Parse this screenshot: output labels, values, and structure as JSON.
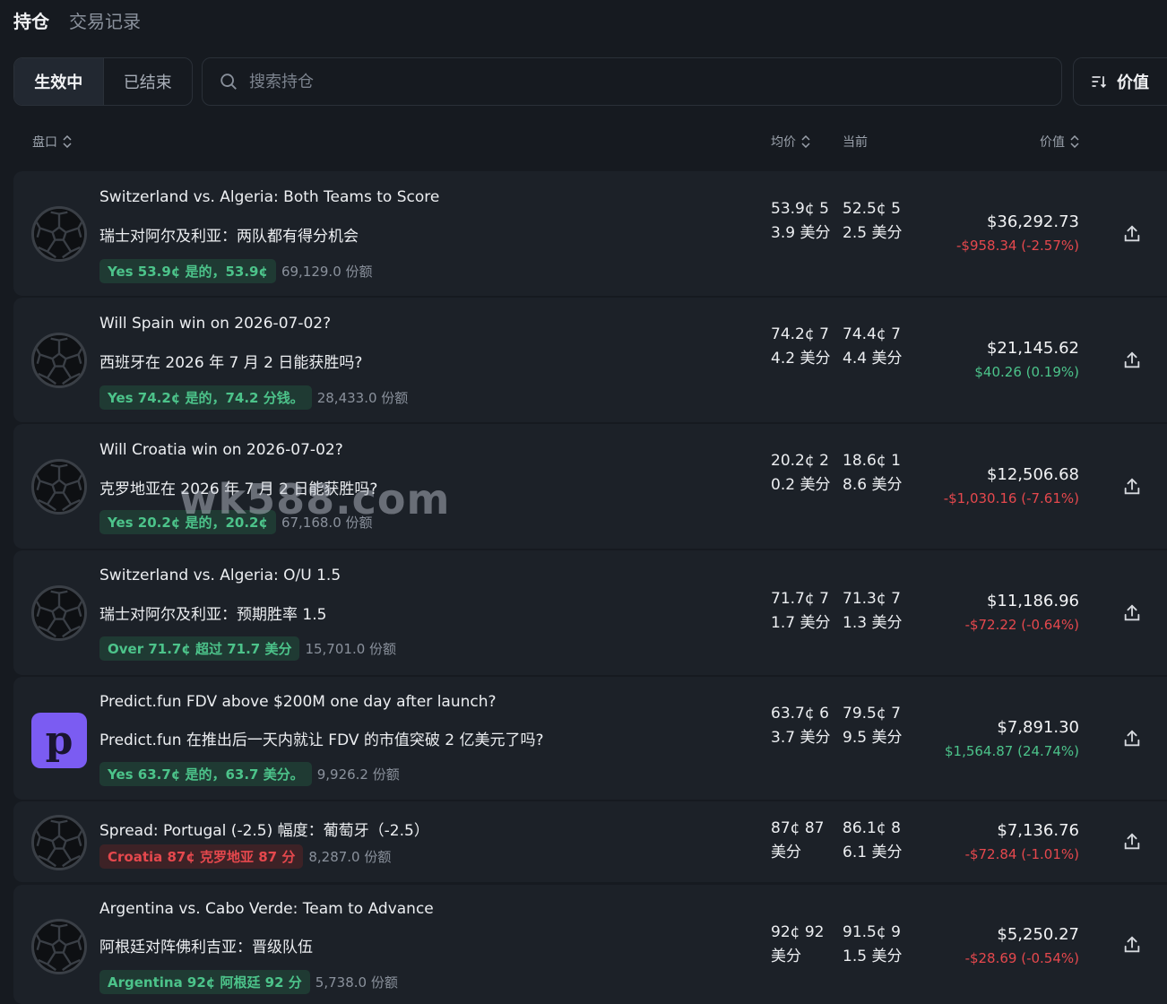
{
  "tabs": [
    {
      "label": "持仓"
    },
    {
      "label": "交易记录"
    }
  ],
  "filter": {
    "active_label": "生效中",
    "ended_label": "已结束"
  },
  "search": {
    "placeholder": "搜索持仓",
    "value": ""
  },
  "sort": {
    "label": "价值"
  },
  "columns": {
    "market": "盘口",
    "avg": "均价",
    "current": "当前",
    "value": "价值"
  },
  "rows": [
    {
      "icon": "soccer-ball-icon",
      "title_en": "Switzerland vs. Algeria: Both Teams to Score",
      "title_zh": "瑞士对阿尔及利亚：两队都有得分机会",
      "tag": "Yes 53.9¢  是的，53.9¢",
      "tag_kind": "yes",
      "shares": "69,129.0 份额",
      "avg": "53.9¢ 53.9 美分",
      "current": "52.5¢ 52.5 美分",
      "value": "$36,292.73",
      "pnl": "-$958.34 (-2.57%)",
      "pnl_kind": "neg"
    },
    {
      "icon": "soccer-ball-icon",
      "title_en": "Will Spain win on 2026-07-02?",
      "title_zh": "西班牙在 2026 年 7 月 2 日能获胜吗?",
      "tag": "Yes 74.2¢  是的，74.2 分钱。",
      "tag_kind": "yes",
      "shares": "28,433.0 份额",
      "avg": "74.2¢ 74.2 美分",
      "current": "74.4¢ 74.4 美分",
      "value": "$21,145.62",
      "pnl": "$40.26 (0.19%)",
      "pnl_kind": "pos"
    },
    {
      "icon": "soccer-ball-icon",
      "title_en": "Will Croatia win on 2026-07-02?",
      "title_zh": "克罗地亚在 2026 年 7 月 2 日能获胜吗?",
      "tag": "Yes 20.2¢  是的，20.2¢",
      "tag_kind": "yes",
      "shares": "67,168.0 份额",
      "avg": "20.2¢ 20.2 美分",
      "current": "18.6¢ 18.6 美分",
      "value": "$12,506.68",
      "pnl": "-$1,030.16 (-7.61%)",
      "pnl_kind": "neg"
    },
    {
      "icon": "soccer-ball-icon",
      "title_en": "Switzerland vs. Algeria: O/U 1.5",
      "title_zh": "瑞士对阿尔及利亚：预期胜率 1.5",
      "tag": "Over 71.7¢  超过 71.7 美分",
      "tag_kind": "yes",
      "shares": "15,701.0 份额",
      "avg": "71.7¢ 71.7 美分",
      "current": "71.3¢ 71.3 美分",
      "value": "$11,186.96",
      "pnl": "-$72.22 (-0.64%)",
      "pnl_kind": "neg"
    },
    {
      "icon": "predict-fun-logo",
      "logo_letter": "p",
      "title_en": "Predict.fun FDV above $200M one day after launch?",
      "title_zh": "Predict.fun 在推出后一天内就让 FDV 的市值突破 2 亿美元了吗?",
      "tag": "Yes 63.7¢  是的，63.7 美分。",
      "tag_kind": "yes",
      "shares": "9,926.2 份额",
      "avg": "63.7¢ 63.7 美分",
      "current": "79.5¢ 79.5 美分",
      "value": "$7,891.30",
      "pnl": "$1,564.87 (24.74%)",
      "pnl_kind": "pos"
    },
    {
      "icon": "soccer-ball-icon",
      "title_en": "Spread: Portugal (-2.5)  幅度：葡萄牙（-2.5）",
      "title_zh": "",
      "tag": "Croatia 87¢  克罗地亚 87 分",
      "tag_kind": "no",
      "shares": "8,287.0 份额",
      "avg": "87¢ 87 美分",
      "current": "86.1¢ 86.1 美分",
      "value": "$7,136.76",
      "pnl": "-$72.84 (-1.01%)",
      "pnl_kind": "neg"
    },
    {
      "icon": "soccer-ball-icon",
      "title_en": "Argentina vs. Cabo Verde: Team to Advance",
      "title_zh": "阿根廷对阵佛利吉亚：晋级队伍",
      "tag": "Argentina 92¢  阿根廷 92 分",
      "tag_kind": "yes",
      "shares": "5,738.0 份额",
      "avg": "92¢ 92 美分",
      "current": "91.5¢ 91.5 美分",
      "value": "$5,250.27",
      "pnl": "-$28.69 (-0.54%)",
      "pnl_kind": "neg"
    }
  ],
  "watermark": "wk588.com",
  "colors": {
    "background": "#161a20",
    "row": "#1c2128",
    "positive": "#4cc38a",
    "negative": "#e5484d",
    "accent_purple": "#7b5cf2"
  }
}
